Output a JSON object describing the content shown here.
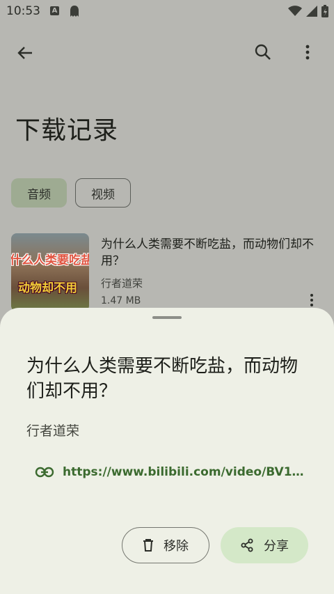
{
  "status_bar": {
    "time": "10:53",
    "a_badge": "A"
  },
  "toolbar": {
    "back_icon": "arrow-back-icon",
    "search_icon": "search-icon",
    "more_icon": "more-vert-icon"
  },
  "page": {
    "title": "下载记录"
  },
  "chips": [
    {
      "label": "音频",
      "selected": true
    },
    {
      "label": "视频",
      "selected": false
    }
  ],
  "item": {
    "thumb_text_1": "什么人类要吃盐",
    "thumb_text_2": "动物却不用",
    "title": "为什么人类需要不断吃盐，而动物们却不用？",
    "author": "行者道荣",
    "size": "1.47 MB"
  },
  "sheet": {
    "title": "为什么人类需要不断吃盐，而动物们却不用？",
    "author": "行者道荣",
    "url": "https://www.bilibili.com/video/BV1…",
    "remove_label": "移除",
    "share_label": "分享"
  },
  "colors": {
    "accent": "#3b6a2f",
    "scrim": "#b7b7b2",
    "sheet": "#eef0e6",
    "chip_selected": "#9eab92",
    "share_bg": "#d4e8c8"
  }
}
